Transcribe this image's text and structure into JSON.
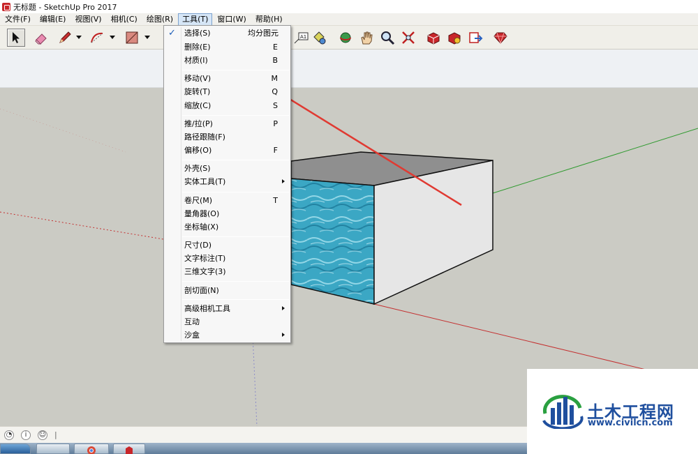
{
  "window": {
    "title": "无标题 - SketchUp Pro 2017"
  },
  "menubar": {
    "items": [
      {
        "label": "文件(F)"
      },
      {
        "label": "编辑(E)"
      },
      {
        "label": "视图(V)"
      },
      {
        "label": "相机(C)"
      },
      {
        "label": "绘图(R)"
      },
      {
        "label": "工具(T)"
      },
      {
        "label": "窗口(W)"
      },
      {
        "label": "帮助(H)"
      }
    ]
  },
  "tools_menu": {
    "items": [
      {
        "label": "选择(S)",
        "shortcut": "均分图元",
        "checked": true
      },
      {
        "label": "删除(E)",
        "shortcut": "E"
      },
      {
        "label": "材质(I)",
        "shortcut": "B"
      },
      {
        "label": "移动(V)",
        "shortcut": "M"
      },
      {
        "label": "旋转(T)",
        "shortcut": "Q"
      },
      {
        "label": "缩放(C)",
        "shortcut": "S"
      },
      {
        "label": "推/拉(P)",
        "shortcut": "P"
      },
      {
        "label": "路径跟随(F)",
        "shortcut": ""
      },
      {
        "label": "偏移(O)",
        "shortcut": "F"
      },
      {
        "label": "外壳(S)",
        "shortcut": ""
      },
      {
        "label": "实体工具(T)",
        "shortcut": "",
        "submenu": true
      },
      {
        "label": "卷尺(M)",
        "shortcut": "T"
      },
      {
        "label": "量角器(O)",
        "shortcut": ""
      },
      {
        "label": "坐标轴(X)",
        "shortcut": ""
      },
      {
        "label": "尺寸(D)",
        "shortcut": ""
      },
      {
        "label": "文字标注(T)",
        "shortcut": ""
      },
      {
        "label": "三维文字(3)",
        "shortcut": ""
      },
      {
        "label": "剖切面(N)",
        "shortcut": ""
      },
      {
        "label": "高级相机工具",
        "shortcut": "",
        "submenu": true
      },
      {
        "label": "互动",
        "shortcut": ""
      },
      {
        "label": "沙盒",
        "shortcut": "",
        "submenu": true
      }
    ]
  },
  "toolbar": {
    "icons": [
      "select-arrow-icon",
      "eraser-icon",
      "pencil-icon",
      "arc-icon",
      "shape-icon",
      "text-label-icon",
      "paint-bucket-icon",
      "orbit-icon",
      "pan-hand-icon",
      "zoom-icon",
      "zoom-extents-icon",
      "3d-warehouse-icon",
      "extension-warehouse-icon",
      "layout-send-icon",
      "ruby-icon"
    ]
  },
  "statusbar": {
    "separator": "|"
  },
  "watermark": {
    "name": "土木工程网",
    "url": "www.civilcn.com"
  },
  "colors": {
    "viewport_bg": "#cbcbc4",
    "axis_green": "#2f9a2f",
    "axis_red": "#c43030",
    "axis_blue_dotted": "#8a8ac8",
    "arrow_red": "#e03a32",
    "box_top": "#8d8d8d",
    "box_side_right": "#e6e6e6",
    "water_texture": "#3aa6c3",
    "menu_highlight": "#d6e6f7",
    "brand_blue": "#1f4f9e"
  }
}
